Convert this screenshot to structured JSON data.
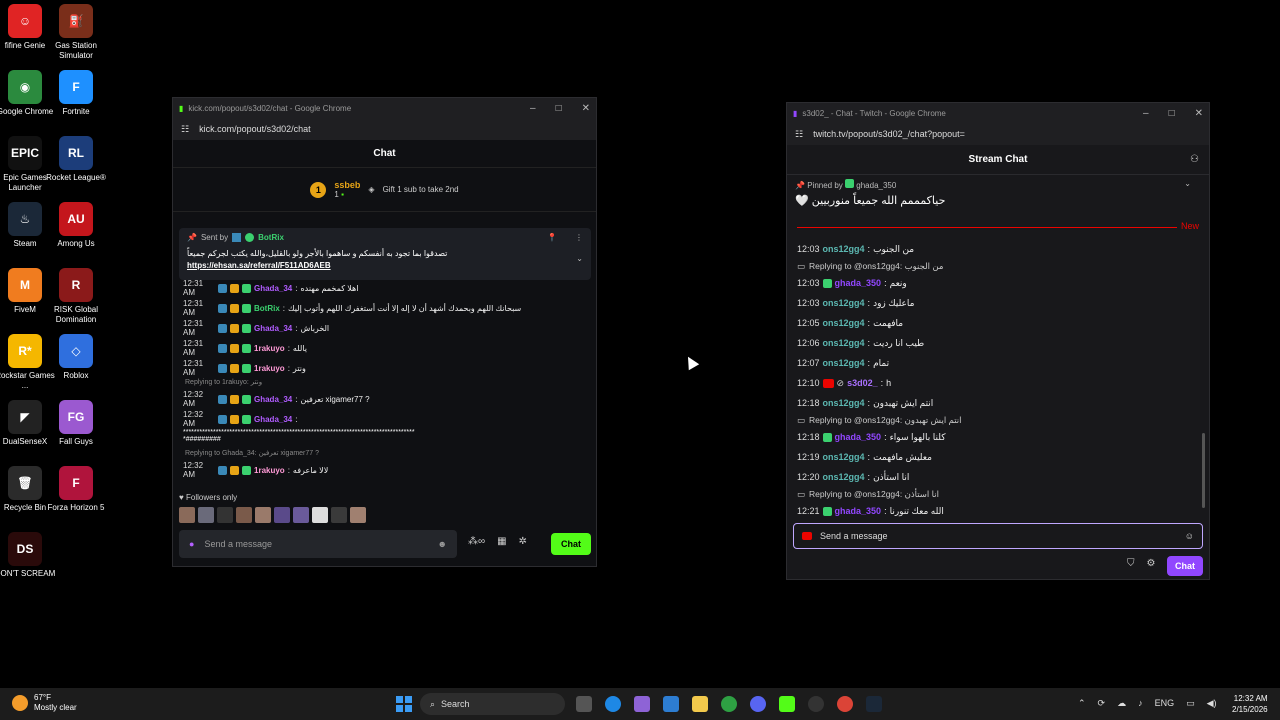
{
  "desktop_icons": [
    {
      "label": "fifine Genie",
      "color": "#e02424",
      "glyph": "☺"
    },
    {
      "label": "Gas Station Simulator",
      "color": "#7a2e1a",
      "glyph": "⛽"
    },
    {
      "label": "Google Chrome",
      "color": "#2b8a3e",
      "glyph": "◉"
    },
    {
      "label": "Fortnite",
      "color": "#1e90ff",
      "glyph": "F"
    },
    {
      "label": "Epic Games Launcher",
      "color": "#111111",
      "glyph": "EPIC"
    },
    {
      "label": "Rocket League®",
      "color": "#1c3d7a",
      "glyph": "RL"
    },
    {
      "label": "Steam",
      "color": "#1b2838",
      "glyph": "♨"
    },
    {
      "label": "Among Us",
      "color": "#c4161c",
      "glyph": "AU"
    },
    {
      "label": "FiveM",
      "color": "#f07c1f",
      "glyph": "M"
    },
    {
      "label": "RISK Global Domination",
      "color": "#8b1a1a",
      "glyph": "R"
    },
    {
      "label": "Rockstar Games ...",
      "color": "#f5b700",
      "glyph": "R*"
    },
    {
      "label": "Roblox",
      "color": "#2f6fde",
      "glyph": "◇"
    },
    {
      "label": "DualSenseX",
      "color": "#222222",
      "glyph": "◤"
    },
    {
      "label": "Fall Guys",
      "color": "#9b59d0",
      "glyph": "FG"
    },
    {
      "label": "Recycle Bin",
      "color": "#2b2b2b",
      "glyph": "🗑"
    },
    {
      "label": "Forza Horizon 5",
      "color": "#b0143c",
      "glyph": "F"
    },
    {
      "label": "DON'T SCREAM",
      "color": "#2a0a0a",
      "glyph": "DS"
    }
  ],
  "kick": {
    "window_title": "kick.com/popout/s3d02/chat - Google Chrome",
    "url": "kick.com/popout/s3d02/chat",
    "chat_header": "Chat",
    "leader_name": "ssbeb",
    "leader_rank": "1",
    "leader_count": "1",
    "gift_text": "Gift 1 sub to take 2nd",
    "pinned_sent_by": "Sent by",
    "pinned_user": "BotRix",
    "pinned_text": "تصدقوا بما تجود به أنفسكم و ساهموا بالأجر ولو بالقليل،والله يكتب لجركم جميعاً",
    "pinned_link": "https://ehsan.sa/referral/F511AD6AEB",
    "messages": [
      {
        "time": "12:31 AM",
        "user": "Ghada_34",
        "text": "اهلا كمخمم مهنده",
        "color": "#b05cff"
      },
      {
        "time": "12:31 AM",
        "user": "BotRix",
        "text": "سبحانك اللهم وبحمدك أشهد أن لا إله إلا أنت أستغفرك اللهم وأتوب إليك",
        "color": "#3bd16f"
      },
      {
        "time": "12:31 AM",
        "user": "Ghada_34",
        "text": "الخرباش",
        "color": "#b05cff"
      },
      {
        "time": "12:31 AM",
        "user": "1rakuyo",
        "text": "يالله",
        "color": "#ff9ad6"
      },
      {
        "time": "12:31 AM",
        "user": "1rakuyo",
        "text": "ونتر",
        "color": "#ff9ad6"
      }
    ],
    "reply1": "Replying to 1rakuyo: ونتر",
    "msg6": {
      "time": "12:32 AM",
      "user": "Ghada_34",
      "text": "تعرفين xigamer77 ?"
    },
    "msg7": {
      "time": "12:32 AM",
      "user": "Ghada_34",
      "text": ""
    },
    "stars_line1": "*************************************************************************************",
    "stars_line2": "*#########",
    "reply2": "Replying to Ghada_34: تعرفين xigamer77 ?",
    "msg8": {
      "time": "12:32 AM",
      "user": "1rakuyo",
      "text": "لالا ماعرفه"
    },
    "followers_only": "Followers only",
    "input_placeholder": "Send a message",
    "chat_button": "Chat"
  },
  "twitch": {
    "window_title": "s3d02_ - Chat - Twitch - Google Chrome",
    "url": "twitch.tv/popout/s3d02_/chat?popout=",
    "chat_header": "Stream Chat",
    "pinned_by": "Pinned by",
    "pinned_user": "ghada_350",
    "pinned_text": "حياكمممم الله جميعاً منوربيين 🤍",
    "new_label": "New",
    "messages": [
      {
        "kind": "msg",
        "time": "12:03",
        "user": "ons12gg4",
        "text": "من الجنوب",
        "cls": "u1"
      },
      {
        "kind": "reply",
        "text": "Replying to @ons12gg4: من الجنوب"
      },
      {
        "kind": "msg",
        "time": "12:03",
        "user": "ghada_350",
        "text": "ونعم",
        "cls": "u2"
      },
      {
        "kind": "msg",
        "time": "12:03",
        "user": "ons12gg4",
        "text": "ماعليك زود",
        "cls": "u1"
      },
      {
        "kind": "msg",
        "time": "12:05",
        "user": "ons12gg4",
        "text": "مافهمت",
        "cls": "u1"
      },
      {
        "kind": "msg",
        "time": "12:06",
        "user": "ons12gg4",
        "text": "طيب انا رديت",
        "cls": "u1"
      },
      {
        "kind": "msg",
        "time": "12:07",
        "user": "ons12gg4",
        "text": "تمام",
        "cls": "u1"
      },
      {
        "kind": "msg",
        "time": "12:10",
        "user": "s3d02_",
        "text": "h",
        "cls": "u3"
      },
      {
        "kind": "msg",
        "time": "12:18",
        "user": "ons12gg4",
        "text": "انتم ايش تهبدون",
        "cls": "u1"
      },
      {
        "kind": "reply",
        "text": "Replying to @ons12gg4: انتم ايش تهبدون"
      },
      {
        "kind": "msg",
        "time": "12:18",
        "user": "ghada_350",
        "text": "كلنا بالهوا سواء",
        "cls": "u2"
      },
      {
        "kind": "msg",
        "time": "12:19",
        "user": "ons12gg4",
        "text": "معليش مافهمت",
        "cls": "u1"
      },
      {
        "kind": "msg",
        "time": "12:20",
        "user": "ons12gg4",
        "text": "انا استأذن",
        "cls": "u1"
      },
      {
        "kind": "reply",
        "text": "Replying to @ons12gg4: انا استأذن"
      },
      {
        "kind": "msg",
        "time": "12:21",
        "user": "ghada_350",
        "text": "الله معك تنورنا",
        "cls": "u2"
      }
    ],
    "input_placeholder": "Send a message",
    "chat_button": "Chat"
  },
  "taskbar": {
    "temp": "67°F",
    "weather": "Mostly clear",
    "search": "Search",
    "lang": "ENG",
    "time": "12:32 AM",
    "date": "2/15/2026"
  }
}
